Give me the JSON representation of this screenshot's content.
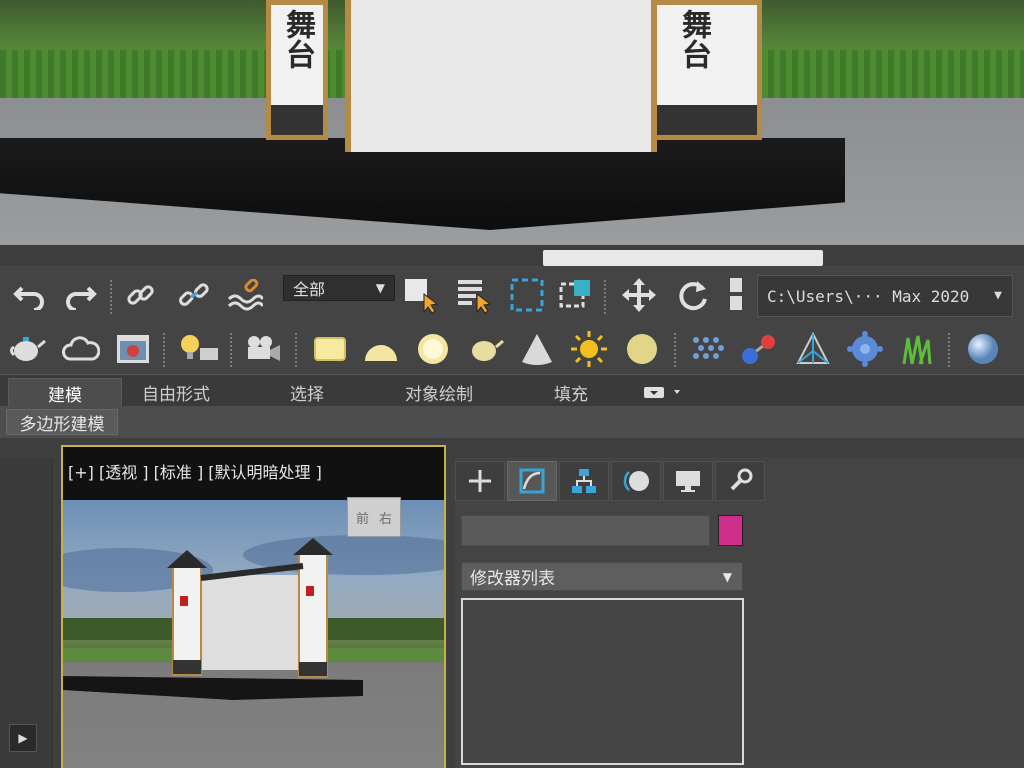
{
  "render_top": {
    "sign_left": "舞台",
    "sign_right": "舞台"
  },
  "toolbar1": {
    "selection_filter": "全部",
    "project_path": "C:\\Users\\··· Max 2020",
    "icons": [
      "undo-icon",
      "redo-icon",
      "link-icon",
      "unlink-icon",
      "bind-space-warp-icon",
      "select-object-icon",
      "select-by-name-icon",
      "rect-selection-region-icon",
      "window-crossing-icon",
      "move-icon",
      "rotate-icon",
      "scale-icon"
    ]
  },
  "toolbar2": {
    "icons": [
      "teapot-icon",
      "cloud-icon",
      "render-frame-icon",
      "light-lister-icon",
      "camera-icon",
      "plane-icon",
      "hemisphere-icon",
      "sphere-glow-icon",
      "teapot-outline-icon",
      "cone-icon",
      "sun-icon",
      "disc-icon",
      "particle-icon",
      "molecule-icon",
      "pyramid-icon",
      "gear-blob-icon",
      "grass-icon",
      "sphere-icon"
    ]
  },
  "ribbon": {
    "tabs": [
      "建模",
      "自由形式",
      "选择",
      "对象绘制",
      "填充"
    ],
    "subtab": "多边形建模"
  },
  "viewport": {
    "label": "[+] [透视 ] [标准 ] [默认明暗处理 ]",
    "viewcube_front": "前",
    "viewcube_right": "右"
  },
  "command_panel": {
    "tabs": [
      "create-tab",
      "modify-tab",
      "hierarchy-tab",
      "motion-tab",
      "display-tab",
      "utilities-tab"
    ],
    "modifier_list": "修改器列表",
    "color_swatch": "#cf2f8a"
  }
}
